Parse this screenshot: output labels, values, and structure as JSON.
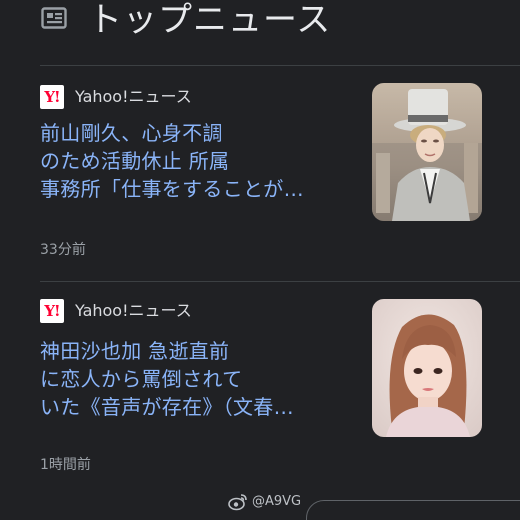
{
  "header": {
    "icon": "newspaper-icon",
    "title": "トップニュース"
  },
  "articles": [
    {
      "source_icon": "yahoo-logo-icon",
      "source_logo_text": "Y!",
      "source": "Yahoo!ニュース",
      "headline_lines": [
        "前山剛久、心身不調",
        "のため活動休止 所属",
        "事務所「仕事をすることが…"
      ],
      "time": "33分前"
    },
    {
      "source_icon": "yahoo-logo-icon",
      "source_logo_text": "Y!",
      "source": "Yahoo!ニュース",
      "headline_lines": [
        "神田沙也加 急逝直前",
        "に恋人から罵倒されて",
        "いた《音声が存在》（文春…"
      ],
      "time": "1時間前"
    }
  ],
  "watermark": {
    "icon": "weibo-icon",
    "text": "@A9VG"
  },
  "colors": {
    "background": "#202124",
    "headline": "#8ab4f8",
    "muted": "#9aa0a6",
    "divider": "#3c4043",
    "brand": "#ff0033"
  }
}
